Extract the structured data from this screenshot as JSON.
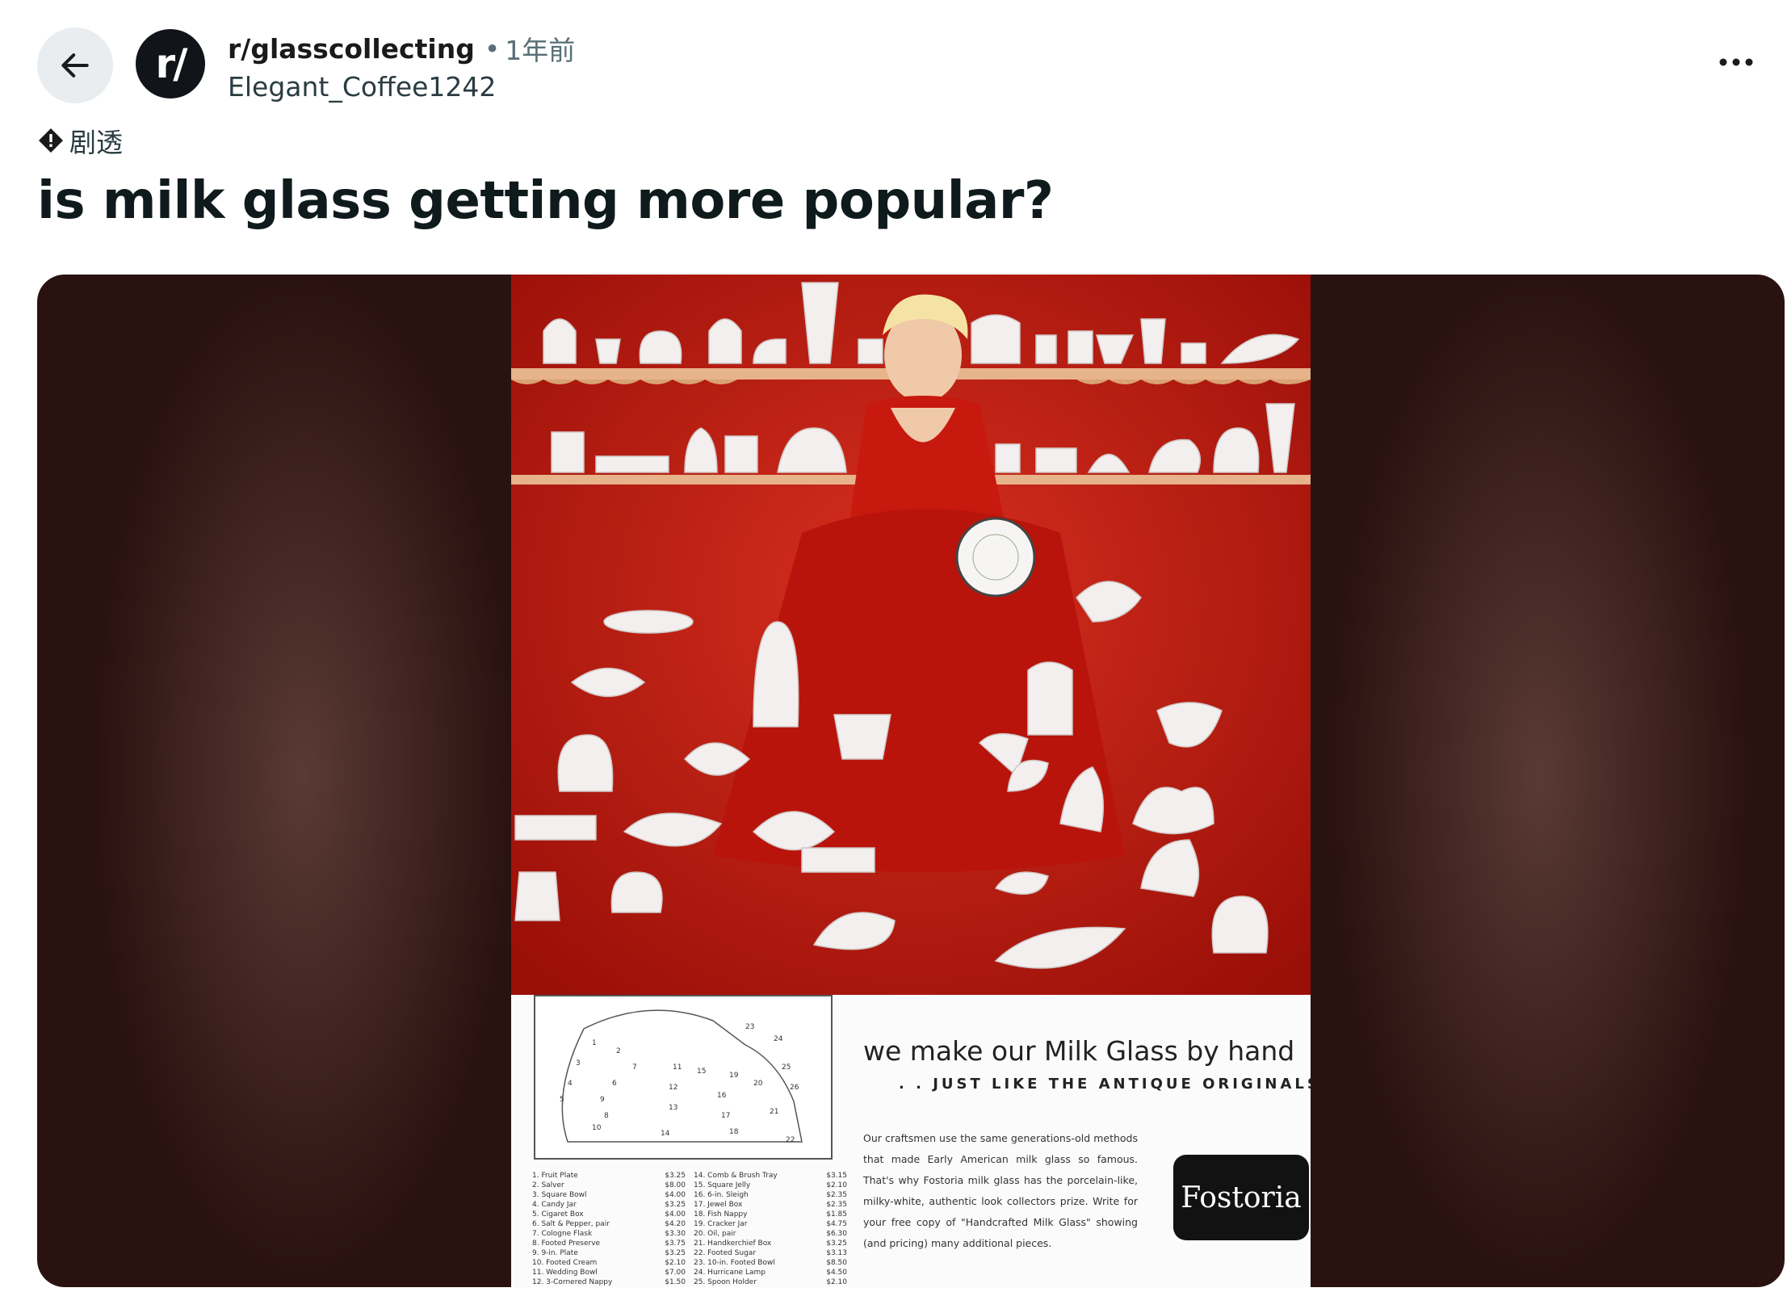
{
  "header": {
    "subreddit": "r/glasscollecting",
    "separator": "•",
    "time": "1年前",
    "author": "Elegant_Coffee1242",
    "avatar_text": "r/"
  },
  "post": {
    "flair": "剧透",
    "title": "is milk glass getting more popular?"
  },
  "ad": {
    "headline": "we make our Milk Glass by hand",
    "subheadline": ". . JUST LIKE THE ANTIQUE ORIGINALS",
    "body": "Our craftsmen use the same generations-old methods that made Early American milk glass so famous. That's why Fostoria milk glass has the porcelain-like, milky-white, authentic look collectors prize. Write for your free copy of \"Handcrafted Milk Glass\" showing (and pricing) many additional pieces.",
    "logo": "Fostoria",
    "price_list_left": [
      {
        "item": "1. Fruit Plate",
        "price": "$3.25"
      },
      {
        "item": "2. Salver",
        "price": "$8.00"
      },
      {
        "item": "3. Square Bowl",
        "price": "$4.00"
      },
      {
        "item": "4. Candy Jar",
        "price": "$3.25"
      },
      {
        "item": "5. Cigaret Box",
        "price": "$4.00"
      },
      {
        "item": "6. Salt & Pepper, pair",
        "price": "$4.20"
      },
      {
        "item": "7. Cologne Flask",
        "price": "$3.30"
      },
      {
        "item": "8. Footed Preserve",
        "price": "$3.75"
      },
      {
        "item": "9. 9-in. Plate",
        "price": "$3.25"
      },
      {
        "item": "10. Footed Cream",
        "price": "$2.10"
      },
      {
        "item": "11. Wedding Bowl",
        "price": "$7.00"
      },
      {
        "item": "12. 3-Cornered Nappy",
        "price": "$1.50"
      }
    ],
    "price_list_right": [
      {
        "item": "14. Comb & Brush Tray",
        "price": "$3.15"
      },
      {
        "item": "15. Square Jelly",
        "price": "$2.10"
      },
      {
        "item": "16. 6-in. Sleigh",
        "price": "$2.35"
      },
      {
        "item": "17. Jewel Box",
        "price": "$2.35"
      },
      {
        "item": "18. Fish Nappy",
        "price": "$1.85"
      },
      {
        "item": "19. Cracker Jar",
        "price": "$4.75"
      },
      {
        "item": "20. Oil, pair",
        "price": "$6.30"
      },
      {
        "item": "21. Handkerchief Box",
        "price": "$3.25"
      },
      {
        "item": "22. Footed Sugar",
        "price": "$3.13"
      },
      {
        "item": "23. 10-in. Footed Bowl",
        "price": "$8.50"
      },
      {
        "item": "24. Hurricane Lamp",
        "price": "$4.50"
      },
      {
        "item": "25. Spoon Holder",
        "price": "$2.10"
      }
    ],
    "diagram_numbers": [
      "1",
      "2",
      "3",
      "4",
      "5",
      "6",
      "7",
      "8",
      "9",
      "10",
      "11",
      "12",
      "13",
      "14",
      "15",
      "16",
      "17",
      "18",
      "19",
      "20",
      "21",
      "22",
      "23",
      "24",
      "25",
      "26"
    ]
  },
  "icons": {
    "back": "arrow-left-icon",
    "more": "ellipsis-horizontal-icon",
    "flair": "spoiler-diamond-icon"
  },
  "colors": {
    "background": "#ffffff",
    "back_button_bg": "#eaedef",
    "media_bg": "#2a1210",
    "ad_red": "#c41a12",
    "text_primary": "#0f1a1c",
    "text_meta": "#576f76"
  }
}
